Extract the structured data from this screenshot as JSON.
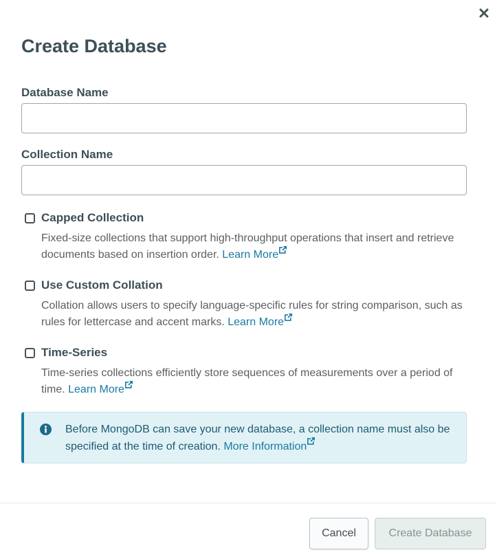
{
  "dialog": {
    "title": "Create Database",
    "close_icon": "close-icon"
  },
  "fields": {
    "database_name": {
      "label": "Database Name",
      "value": "",
      "placeholder": ""
    },
    "collection_name": {
      "label": "Collection Name",
      "value": "",
      "placeholder": ""
    }
  },
  "options": [
    {
      "title": "Capped Collection",
      "checked": false,
      "description": "Fixed-size collections that support high-throughput operations that insert and retrieve documents based on insertion order.",
      "link": "Learn More"
    },
    {
      "title": "Use Custom Collation",
      "checked": false,
      "description": "Collation allows users to specify language-specific rules for string comparison, such as rules for lettercase and accent marks.",
      "link": "Learn More"
    },
    {
      "title": "Time-Series",
      "checked": false,
      "description": "Time-series collections efficiently store sequences of measurements over a period of time.",
      "link": "Learn More"
    }
  ],
  "info_banner": {
    "icon": "info-icon",
    "text": "Before MongoDB can save your new database, a collection name must also be specified at the time of creation.",
    "link": "More Information"
  },
  "footer": {
    "cancel_label": "Cancel",
    "create_label": "Create Database"
  },
  "colors": {
    "title": "#3d4f58",
    "link": "#1a7aa3",
    "banner_bg": "#e1f2f6",
    "banner_accent": "#1a7aa3",
    "disabled_button_bg": "#e7eeec"
  }
}
